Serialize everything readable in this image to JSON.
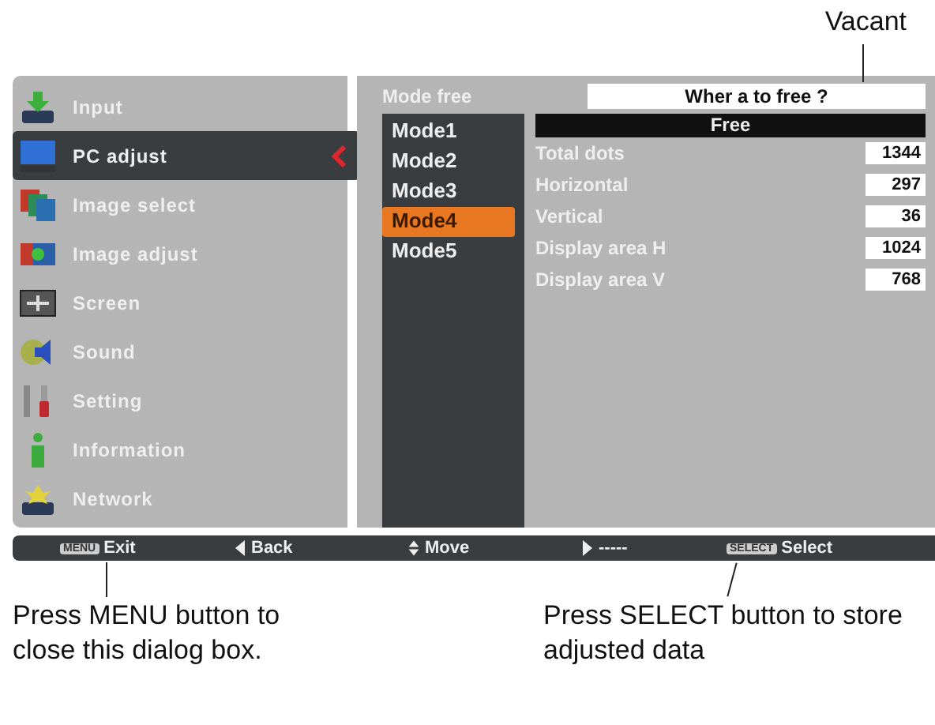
{
  "top_callout": "Vacant",
  "menu": [
    {
      "label": "Input",
      "kind": "input",
      "selected": false
    },
    {
      "label": "PC adjust",
      "kind": "monitor",
      "selected": true
    },
    {
      "label": "Image select",
      "kind": "images",
      "selected": false
    },
    {
      "label": "Image adjust",
      "kind": "adjust",
      "selected": false
    },
    {
      "label": "Screen",
      "kind": "screen",
      "selected": false
    },
    {
      "label": "Sound",
      "kind": "speaker",
      "selected": false
    },
    {
      "label": "Setting",
      "kind": "tools",
      "selected": false
    },
    {
      "label": "Information",
      "kind": "info",
      "selected": false
    },
    {
      "label": "Network",
      "kind": "network",
      "selected": false
    }
  ],
  "submenu": {
    "title": "Mode free",
    "name_field": {
      "value": "Wher a to free ?"
    },
    "modes": [
      {
        "label": "Mode1",
        "selected": false
      },
      {
        "label": "Mode2",
        "selected": false
      },
      {
        "label": "Mode3",
        "selected": false
      },
      {
        "label": "Mode4",
        "selected": true
      },
      {
        "label": "Mode5",
        "selected": false
      }
    ],
    "header": "Free",
    "rows": [
      {
        "label": "Total dots",
        "value": "1344"
      },
      {
        "label": "Horizontal",
        "value": "297"
      },
      {
        "label": "Vertical",
        "value": "36"
      },
      {
        "label": "Display area H",
        "value": "1024"
      },
      {
        "label": "Display area V",
        "value": "768"
      }
    ]
  },
  "footer": [
    {
      "kind": "key",
      "key": "MENU",
      "label": "Exit"
    },
    {
      "kind": "left",
      "label": "Back"
    },
    {
      "kind": "updown",
      "label": "Move"
    },
    {
      "kind": "right",
      "label": "-----"
    },
    {
      "kind": "key",
      "key": "SELECT",
      "label": "Select"
    }
  ],
  "callouts": [
    "Press MENU button to close this dialog box.",
    "Press SELECT button to store adjusted data"
  ]
}
